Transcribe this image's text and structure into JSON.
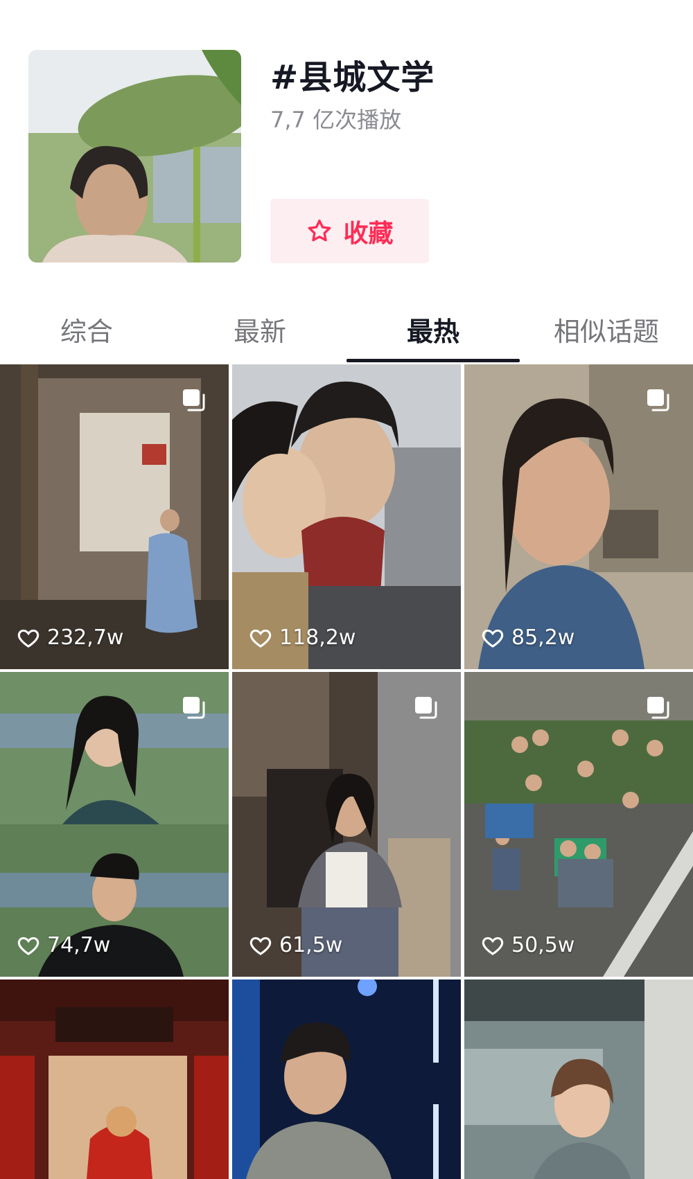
{
  "topic": {
    "title": "#县城文学",
    "plays": "7,7 亿次播放",
    "favorite_label": "收藏",
    "cover_icon": "cover-image"
  },
  "tabs": [
    {
      "label": "综合",
      "active": false
    },
    {
      "label": "最新",
      "active": false
    },
    {
      "label": "最热",
      "active": true
    },
    {
      "label": "相似话题",
      "active": false
    }
  ],
  "videos": [
    {
      "likes": "232,7w",
      "multi_image": true
    },
    {
      "likes": "118,2w",
      "multi_image": false
    },
    {
      "likes": "85,2w",
      "multi_image": true
    },
    {
      "likes": "74,7w",
      "multi_image": true
    },
    {
      "likes": "61,5w",
      "multi_image": true
    },
    {
      "likes": "50,5w",
      "multi_image": true
    },
    {
      "likes": "",
      "multi_image": false
    },
    {
      "likes": "",
      "multi_image": false
    },
    {
      "likes": "",
      "multi_image": false
    }
  ],
  "colors": {
    "accent": "#fe2c55",
    "accent_bg": "#fdeef1",
    "text_primary": "#161823",
    "text_secondary": "#8a8b91"
  }
}
